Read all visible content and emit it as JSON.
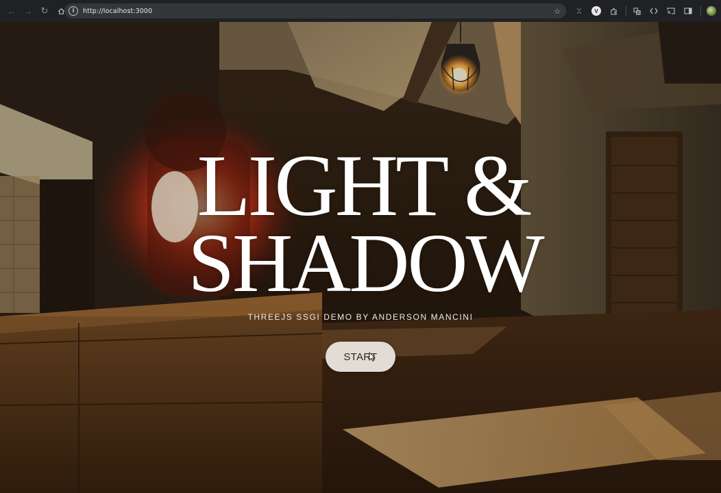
{
  "browser": {
    "url": "http://localhost:3000",
    "icons": {
      "back": "arrow-left-icon",
      "forward": "arrow-right-icon",
      "reload": "reload-icon",
      "home": "home-icon",
      "site_info": "info-icon",
      "bookmark": "star-icon",
      "menu": "kebab-menu-icon"
    },
    "toolbar_icons": [
      "extension-icon",
      "puzzle-icon",
      "translate-icon",
      "code-icon",
      "cast-icon",
      "sidepanel-icon",
      "profile-avatar-icon"
    ]
  },
  "hero": {
    "title_line1": "LIGHT &",
    "title_line2": "SHADOW",
    "subtitle": "THREEJS SSGI DEMO BY ANDERSON MANCINI",
    "start_label": "START"
  },
  "colors": {
    "chrome_bg": "#202124",
    "omnibox_bg": "#35363a",
    "title": "#ffffff",
    "button_bg": "#e3dcd4",
    "lamp_glow": "#ff5a2a",
    "scene_warm": "#b07a3c"
  }
}
